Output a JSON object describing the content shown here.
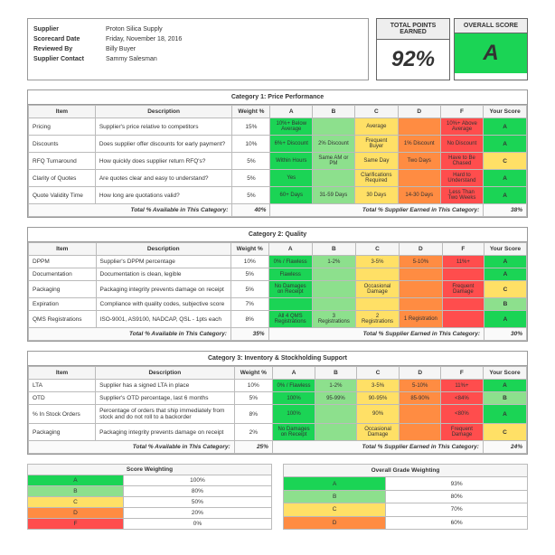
{
  "meta": {
    "supplier_k": "Supplier",
    "supplier_v": "Proton Silica Supply",
    "date_k": "Scorecard Date",
    "date_v": "Friday, November 18, 2016",
    "rev_k": "Reviewed By",
    "rev_v": "Billy Buyer",
    "contact_k": "Supplier Contact",
    "contact_v": "Sammy Salesman"
  },
  "score": {
    "points_t": "TOTAL POINTS EARNED",
    "points_v": "92%",
    "grade_t": "OVERALL SCORE",
    "grade_v": "A"
  },
  "cols": {
    "item": "Item",
    "desc": "Description",
    "w": "Weight %",
    "a": "A",
    "b": "B",
    "c": "C",
    "d": "D",
    "f": "F",
    "ys": "Your Score"
  },
  "cat1": {
    "title": "Category 1: Price Performance",
    "rows": [
      {
        "item": "Pricing",
        "desc": "Supplier's price relative to competitors",
        "w": "15%",
        "a": "10%+ Below Average",
        "b": "",
        "c": "Average",
        "d": "",
        "f": "10%+ Above Average",
        "ys": "A"
      },
      {
        "item": "Discounts",
        "desc": "Does supplier offer discounts for early payment?",
        "w": "10%",
        "a": "6%+ Discount",
        "b": "2% Discount",
        "c": "Frequent Buyer",
        "d": "1% Discount",
        "f": "No Discount",
        "ys": "A"
      },
      {
        "item": "RFQ Turnaround",
        "desc": "How quickly does supplier return RFQ's?",
        "w": "5%",
        "a": "Within Hours",
        "b": "Same AM or PM",
        "c": "Same Day",
        "d": "Two Days",
        "f": "Have to Be Chased",
        "ys": "C"
      },
      {
        "item": "Clarity of Quotes",
        "desc": "Are quotes clear and easy to understand?",
        "w": "5%",
        "a": "Yes",
        "b": "",
        "c": "Clarifications Required",
        "d": "",
        "f": "Hard to Understand",
        "ys": "A"
      },
      {
        "item": "Quote Validity Time",
        "desc": "How long are quotations valid?",
        "w": "5%",
        "a": "60+ Days",
        "b": "31-59 Days",
        "c": "30 Days",
        "d": "14-30 Days",
        "f": "Less Than Two Weeks",
        "ys": "A"
      }
    ],
    "tot_l": "Total % Available in This Category:",
    "tot_lv": "40%",
    "tot_r": "Total % Supplier Earned in This Category:",
    "tot_rv": "38%"
  },
  "cat2": {
    "title": "Category 2: Quality",
    "rows": [
      {
        "item": "DPPM",
        "desc": "Supplier's DPPM percentage",
        "w": "10%",
        "a": "0% / Flawless",
        "b": "1-2%",
        "c": "3-5%",
        "d": "5-10%",
        "f": "11%+",
        "ys": "A"
      },
      {
        "item": "Documentation",
        "desc": "Documentation is clean, legible",
        "w": "5%",
        "a": "Flawless",
        "b": "",
        "c": "",
        "d": "",
        "f": "",
        "ys": "A"
      },
      {
        "item": "Packaging",
        "desc": "Packaging integrity prevents damage on receipt",
        "w": "5%",
        "a": "No Damages on Receipt",
        "b": "",
        "c": "Occasional Damage",
        "d": "",
        "f": "Frequent Damage",
        "ys": "C"
      },
      {
        "item": "Expiration",
        "desc": "Compliance with quality codes, subjective score",
        "w": "7%",
        "a": "",
        "b": "",
        "c": "",
        "d": "",
        "f": "",
        "ys": "B"
      },
      {
        "item": "QMS Registrations",
        "desc": "ISO-9001, AS9100, NADCAP, QSL - 1pts each",
        "w": "8%",
        "a": "All 4 QMS Registrations",
        "b": "3 Registrations",
        "c": "2 Registrations",
        "d": "1 Registration",
        "f": "",
        "ys": "A"
      }
    ],
    "tot_l": "Total % Available in This Category:",
    "tot_lv": "35%",
    "tot_r": "Total % Supplier Earned in This Category:",
    "tot_rv": "30%"
  },
  "cat3": {
    "title": "Category 3: Inventory & Stockholding Support",
    "rows": [
      {
        "item": "LTA",
        "desc": "Supplier has a signed LTA in place",
        "w": "10%",
        "a": "0% / Flawless",
        "b": "1-2%",
        "c": "3-5%",
        "d": "5-10%",
        "f": "11%+",
        "ys": "A"
      },
      {
        "item": "OTD",
        "desc": "Supplier's OTD percentage, last 6 months",
        "w": "5%",
        "a": "100%",
        "b": "95-99%",
        "c": "90-95%",
        "d": "85-90%",
        "f": "<84%",
        "ys": "B"
      },
      {
        "item": "% In Stock Orders",
        "desc": "Percentage of orders that ship immediately from stock and do not roll to a backorder",
        "w": "8%",
        "a": "100%",
        "b": "",
        "c": "90%",
        "d": "",
        "f": "<80%",
        "ys": "A"
      },
      {
        "item": "Packaging",
        "desc": "Packaging integrity prevents damage on receipt",
        "w": "2%",
        "a": "No Damages on Receipt",
        "b": "",
        "c": "Occasional Damage",
        "d": "",
        "f": "Frequent Damage",
        "ys": "C"
      }
    ],
    "tot_l": "Total % Available in This Category:",
    "tot_lv": "25%",
    "tot_r": "Total % Supplier Earned in This Category:",
    "tot_rv": "24%"
  },
  "leg1": {
    "t": "Score Weighting",
    "r": [
      [
        "A",
        "100%"
      ],
      [
        "B",
        "80%"
      ],
      [
        "C",
        "50%"
      ],
      [
        "D",
        "20%"
      ],
      [
        "F",
        "0%"
      ]
    ]
  },
  "leg2": {
    "t": "Overall Grade Weighting",
    "r": [
      [
        "A",
        "93%"
      ],
      [
        "B",
        "80%"
      ],
      [
        "C",
        "70%"
      ],
      [
        "D",
        "60%"
      ]
    ]
  }
}
